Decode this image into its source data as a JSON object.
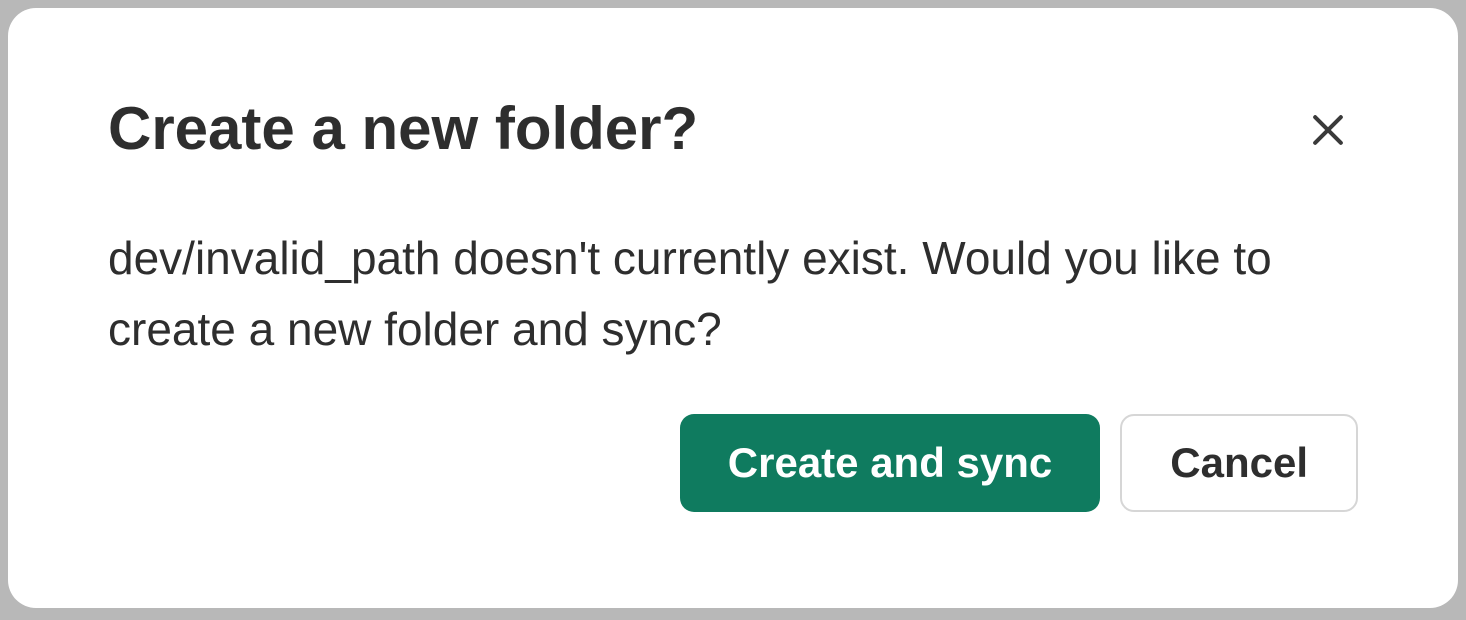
{
  "dialog": {
    "title": "Create a new folder?",
    "body": "dev/invalid_path doesn't currently exist. Would you like to create a new folder and sync?",
    "primary_label": "Create and sync",
    "secondary_label": "Cancel"
  }
}
